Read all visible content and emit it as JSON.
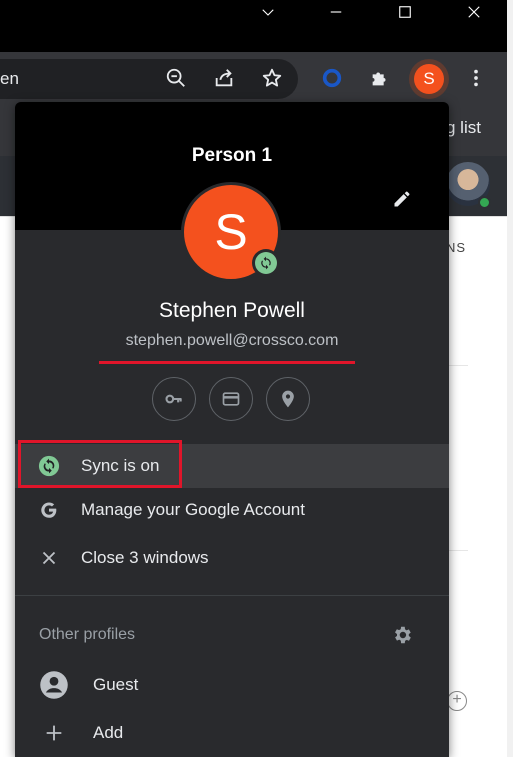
{
  "omnibox": {
    "text": "en"
  },
  "bookmarks": {
    "partial_label": "g list"
  },
  "page": {
    "partial_tab": "NS"
  },
  "profile_popup": {
    "title": "Person 1",
    "avatar_letter": "S",
    "user_name": "Stephen Powell",
    "user_email": "stephen.powell@crossco.com",
    "menu": {
      "sync": "Sync is on",
      "manage_account": "Manage your Google Account",
      "close_windows": "Close 3 windows"
    },
    "other_profiles_label": "Other profiles",
    "profiles": {
      "guest": "Guest",
      "add": "Add"
    }
  },
  "toolbar": {
    "profile_letter": "S"
  },
  "colors": {
    "avatar": "#f4511e",
    "sync_green": "#81c995",
    "highlight_red": "#e0152a",
    "popup_bg": "#292a2d"
  },
  "icons": [
    "chevron-down-icon",
    "maximize-icon",
    "close-icon",
    "zoom-out-icon",
    "share-icon",
    "star-icon",
    "extension-ring-icon",
    "puzzle-icon",
    "kebab-icon",
    "pencil-icon",
    "sync-icon",
    "key-icon",
    "card-icon",
    "pin-icon",
    "google-g-icon",
    "x-icon",
    "gear-icon",
    "person-icon",
    "plus-icon"
  ]
}
